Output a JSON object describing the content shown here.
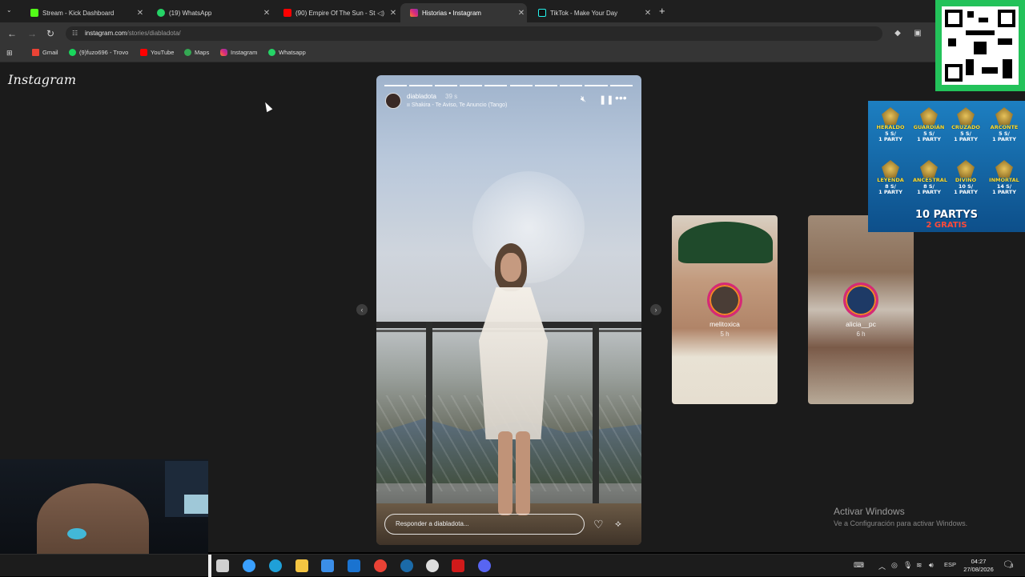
{
  "browser": {
    "tabs": [
      {
        "title": "Stream - Kick Dashboard",
        "favicon": "kick-icon",
        "color": "#53fc18",
        "active": false
      },
      {
        "title": "(19) WhatsApp",
        "favicon": "whatsapp-icon",
        "color": "#25d366",
        "active": false
      },
      {
        "title": "(90) Empire Of The Sun - St",
        "favicon": "youtube-icon",
        "color": "#ff0000",
        "active": false
      },
      {
        "title": "Historias • Instagram",
        "favicon": "instagram-icon",
        "color": "#e1306c",
        "active": true
      },
      {
        "title": "TikTok - Make Your Day",
        "favicon": "tiktok-icon",
        "color": "#111111",
        "active": false
      }
    ],
    "new_tab": "+",
    "url_host": "instagram.com",
    "url_path": "/stories/diabladota/",
    "bookmarks": [
      {
        "label": "Gmail",
        "icon": "gmail-icon",
        "color": "#ea4335"
      },
      {
        "label": "(9)fuzo696 - Trovo",
        "icon": "trovo-icon",
        "color": "#19d65c"
      },
      {
        "label": "YouTube",
        "icon": "youtube-icon",
        "color": "#ff0000"
      },
      {
        "label": "Maps",
        "icon": "maps-icon",
        "color": "#34a853"
      },
      {
        "label": "Instagram",
        "icon": "instagram-icon",
        "color": "#e1306c"
      },
      {
        "label": "Whatsapp",
        "icon": "whatsapp-icon",
        "color": "#25d366"
      }
    ]
  },
  "instagram": {
    "logo": "Instagram",
    "story": {
      "username": "diabladota",
      "time": "39 s",
      "song": "Shakira - Te Aviso, Te Anuncio (Tango)",
      "reply_placeholder": "Responder a diabladota...",
      "segments": 10,
      "current_segment": 10
    },
    "previews": [
      {
        "username": "melitoxica",
        "time": "5 h"
      },
      {
        "username": "alicia__pc",
        "time": "6 h"
      }
    ]
  },
  "overlays": {
    "promo": {
      "ranks": [
        {
          "rank": "HERALDO",
          "price": "5 S/",
          "party": "1 PARTY"
        },
        {
          "rank": "GUARDIÁN",
          "price": "5 S/",
          "party": "1 PARTY"
        },
        {
          "rank": "CRUZADO",
          "price": "5 S/",
          "party": "1 PARTY"
        },
        {
          "rank": "ARCONTE",
          "price": "5 S/",
          "party": "1 PARTY"
        },
        {
          "rank": "LEYENDA",
          "price": "8 S/",
          "party": "1 PARTY"
        },
        {
          "rank": "ANCESTRAL",
          "price": "8 S/",
          "party": "1 PARTY"
        },
        {
          "rank": "DIVINO",
          "price": "10 S/",
          "party": "1 PARTY"
        },
        {
          "rank": "INMORTAL",
          "price": "14 S/",
          "party": "1 PARTY"
        }
      ],
      "title": "10 PARTYS",
      "subtitle": "2 GRATIS"
    },
    "windows_activation": {
      "line1": "Activar Windows",
      "line2": "Ve a Configuración para activar Windows."
    }
  },
  "taskbar": {
    "apps": [
      {
        "icon": "task-view-icon",
        "color": "#cfcfcf"
      },
      {
        "icon": "copilot-icon",
        "color": "#3aa0ff"
      },
      {
        "icon": "edge-icon",
        "color": "#1fa0d8"
      },
      {
        "icon": "file-explorer-icon",
        "color": "#f4c542"
      },
      {
        "icon": "store-icon",
        "color": "#3b8ee8"
      },
      {
        "icon": "outlook-icon",
        "color": "#1a73d0"
      },
      {
        "icon": "chrome-icon",
        "color": "#e94235"
      },
      {
        "icon": "steam-icon",
        "color": "#1b6aa8"
      },
      {
        "icon": "obs-icon",
        "color": "#dddddd"
      },
      {
        "icon": "red-app-icon",
        "color": "#d01a1a"
      },
      {
        "icon": "discord-icon",
        "color": "#5865f2"
      }
    ],
    "language": "ESP",
    "time": "04:27",
    "date": "27/08/2026",
    "notifications": "3"
  }
}
